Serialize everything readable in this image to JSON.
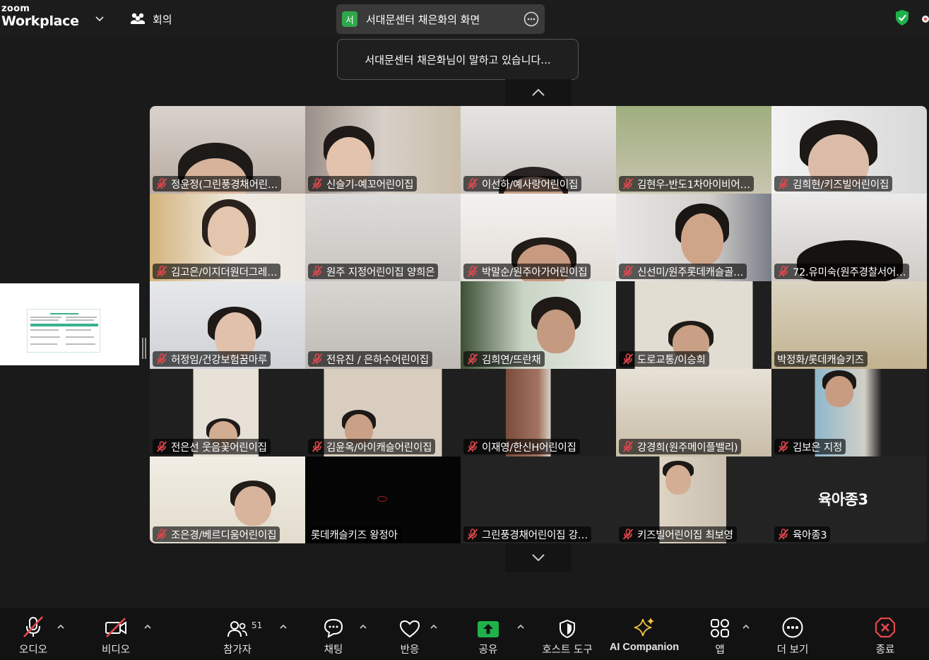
{
  "app": {
    "logo_top": "zoom",
    "logo_bottom": "Workplace",
    "meeting_label": "회의"
  },
  "share": {
    "badge": "서",
    "title": "서대문센터 채은화의 화면"
  },
  "tooltip": {
    "text": "서대문센터 채은화님이 말하고 있습니다..."
  },
  "participants": [
    {
      "name": "정윤정(그린풍경채어린…",
      "muted": true
    },
    {
      "name": "신슬기-예꼬어린이집",
      "muted": true
    },
    {
      "name": "이선하/예사랑어린이집",
      "muted": true
    },
    {
      "name": "김현우-반도1차아이비어…",
      "muted": true
    },
    {
      "name": "김희현/키즈빌어린이집",
      "muted": true
    },
    {
      "name": "김고은/이지더원더그레…",
      "muted": true
    },
    {
      "name": "원주 지정어린이집 양희은",
      "muted": true
    },
    {
      "name": "박말순/원주아가어린이집",
      "muted": true
    },
    {
      "name": "신선미/원주롯데캐슬골…",
      "muted": true
    },
    {
      "name": "72.유미숙(원주경찰서어…",
      "muted": true
    },
    {
      "name": "허정임/건강보험꿈마루",
      "muted": true
    },
    {
      "name": "전유진 / 은하수어린이집",
      "muted": true
    },
    {
      "name": "김희연/뜨란채",
      "muted": true
    },
    {
      "name": "도로교통/이승희",
      "muted": true
    },
    {
      "name": "박정화/롯데캐슬키즈",
      "muted": false
    },
    {
      "name": "전은선 웃음꽃어린이집",
      "muted": true
    },
    {
      "name": "김윤옥/아이캐슬어린이집",
      "muted": true
    },
    {
      "name": "이재영/한신H어린이집",
      "muted": true
    },
    {
      "name": "강경희(원주메이플밸리)",
      "muted": true
    },
    {
      "name": "김보은 지정",
      "muted": true
    },
    {
      "name": "조은경/베르디움어린이집",
      "muted": true
    },
    {
      "name": "롯데캐슬키즈 왕정아",
      "muted": false
    },
    {
      "name": "그린풍경채어린이집 강…",
      "muted": true
    },
    {
      "name": "키즈빌어린이집 최보영",
      "muted": true
    },
    {
      "name": "육아종3",
      "muted": true
    }
  ],
  "big_tile_name": "육아종3",
  "toolbar": {
    "audio": "오디오",
    "video": "비디오",
    "participants": "참가자",
    "participants_count": "51",
    "chat": "채팅",
    "reactions": "반응",
    "share": "공유",
    "host_tools": "호스트 도구",
    "ai_companion": "AI Companion",
    "apps": "앱",
    "more": "더 보기",
    "end": "종료"
  },
  "colors": {
    "share_green": "#2ea84a",
    "shield_green": "#1fb24a",
    "end_red": "#e5484d",
    "ai_gold": "#f5c542",
    "muted_red": "#e5484d"
  }
}
